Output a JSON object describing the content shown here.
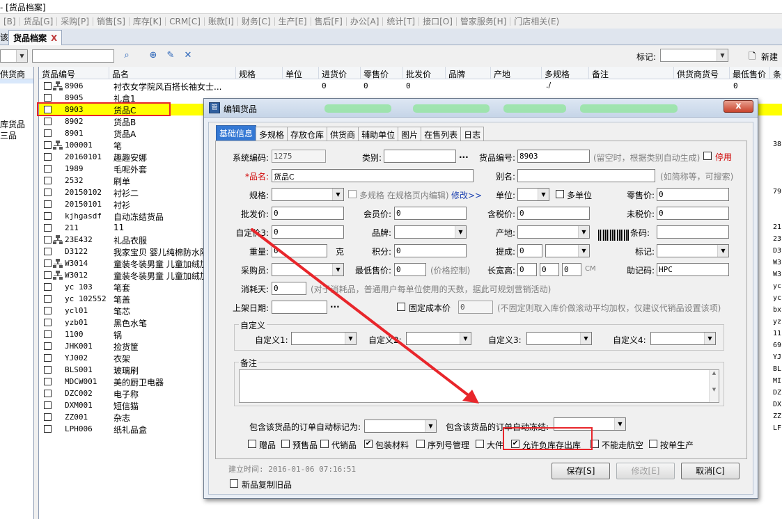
{
  "window_title": "- [货品档案]",
  "menu": [
    "[B]",
    "货品[G]",
    "采购[P]",
    "销售[S]",
    "库存[K]",
    "CRM[C]",
    "账款[I]",
    "财务[C]",
    "生产[E]",
    "售后[F]",
    "办公[A]",
    "统计[T]",
    "接口[O]",
    "管家服务[H]",
    "门店相关(E)"
  ],
  "tabs": {
    "prev_label": "该",
    "active_label": "货品档案",
    "close": "X"
  },
  "toolbar": {
    "mark_label": "标记:",
    "new_label": "新建"
  },
  "left_pane": {
    "header": "供货商",
    "labels": [
      "库货品",
      "三品"
    ]
  },
  "grid": {
    "headers": [
      "货品编号",
      "品名",
      "规格",
      "单位",
      "进货价",
      "零售价",
      "批发价",
      "品牌",
      "产地",
      "多规格",
      "备注",
      "供货商货号",
      "最低售价",
      "条"
    ],
    "rows": [
      {
        "code": "8906",
        "name": "衬衣女学院风百搭长袖女士...",
        "p1": "0",
        "p2": "0",
        "p3": "0",
        "multi": "./",
        "min": "0",
        "edge": ""
      },
      {
        "code": "8905",
        "name": "礼盒1",
        "p1": "",
        "p2": "",
        "p3": "",
        "multi": "",
        "min": "",
        "edge": ""
      },
      {
        "code": "8903",
        "name": "货品C",
        "p1": "",
        "p2": "",
        "p3": "",
        "multi": "",
        "min": "",
        "edge": ""
      },
      {
        "code": "8902",
        "name": "货品B",
        "p1": "",
        "p2": "",
        "p3": "",
        "multi": "",
        "min": "",
        "edge": ""
      },
      {
        "code": "8901",
        "name": "货品A",
        "p1": "",
        "p2": "",
        "p3": "",
        "multi": "",
        "min": "",
        "edge": ""
      },
      {
        "code": "100001",
        "name": "笔",
        "p1": "",
        "p2": "",
        "p3": "",
        "multi": "",
        "min": "",
        "edge": "38"
      },
      {
        "code": "20160101",
        "name": "趣趣安娜",
        "p1": "",
        "p2": "",
        "p3": "",
        "multi": "",
        "min": "",
        "edge": ""
      },
      {
        "code": "1989",
        "name": "毛呢外套",
        "p1": "",
        "p2": "",
        "p3": "",
        "multi": "",
        "min": "",
        "edge": ""
      },
      {
        "code": "2532",
        "name": "刷单",
        "p1": "",
        "p2": "",
        "p3": "",
        "multi": "",
        "min": "",
        "edge": ""
      },
      {
        "code": "20150102",
        "name": "衬衫二",
        "p1": "",
        "p2": "",
        "p3": "",
        "multi": "",
        "min": "",
        "edge": "79"
      },
      {
        "code": "20150101",
        "name": "衬衫",
        "p1": "",
        "p2": "",
        "p3": "",
        "multi": "",
        "min": "",
        "edge": ""
      },
      {
        "code": "kjhgasdf",
        "name": "自动冻结货品",
        "p1": "",
        "p2": "",
        "p3": "",
        "multi": "",
        "min": "",
        "edge": ""
      },
      {
        "code": "211",
        "name": "11",
        "p1": "",
        "p2": "",
        "p3": "",
        "multi": "",
        "min": "",
        "edge": "21"
      },
      {
        "code": "23E432",
        "name": "礼品衣服",
        "p1": "",
        "p2": "",
        "p3": "",
        "multi": "",
        "min": "",
        "edge": "23"
      },
      {
        "code": "D3122",
        "name": "我家宝贝 婴儿纯棉防水隔",
        "p1": "",
        "p2": "",
        "p3": "",
        "multi": "",
        "min": "",
        "edge": "D3"
      },
      {
        "code": "W3014",
        "name": "童装冬装男童 儿童加绒加",
        "p1": "",
        "p2": "",
        "p3": "",
        "multi": "",
        "min": "",
        "edge": "W3"
      },
      {
        "code": "W3012",
        "name": "童装冬装男童 儿童加绒加",
        "p1": "",
        "p2": "",
        "p3": "",
        "multi": "",
        "min": "",
        "edge": "W3"
      },
      {
        "code": "yc 103",
        "name": "笔套",
        "p1": "",
        "p2": "",
        "p3": "",
        "multi": "",
        "min": "",
        "edge": "yc"
      },
      {
        "code": "yc 102552",
        "name": "笔盖",
        "p1": "",
        "p2": "",
        "p3": "",
        "multi": "",
        "min": "",
        "edge": "yc"
      },
      {
        "code": "ycl01",
        "name": "笔芯",
        "p1": "",
        "p2": "",
        "p3": "",
        "multi": "",
        "min": "",
        "edge": "bx"
      },
      {
        "code": "yzb01",
        "name": "黑色水笔",
        "p1": "",
        "p2": "",
        "p3": "",
        "multi": "",
        "min": "",
        "edge": "yz"
      },
      {
        "code": "1100",
        "name": "锅",
        "p1": "",
        "p2": "",
        "p3": "",
        "multi": "",
        "min": "",
        "edge": "11"
      },
      {
        "code": "JHK001",
        "name": "捡货筐",
        "p1": "",
        "p2": "",
        "p3": "",
        "multi": "",
        "min": "",
        "edge": "69"
      },
      {
        "code": "YJ002",
        "name": "衣架",
        "p1": "",
        "p2": "",
        "p3": "",
        "multi": "",
        "min": "",
        "edge": "YJ"
      },
      {
        "code": "BLS001",
        "name": "玻璃刷",
        "p1": "",
        "p2": "",
        "p3": "",
        "multi": "",
        "min": "",
        "edge": "BL"
      },
      {
        "code": "MDCW001",
        "name": "美的厨卫电器",
        "p1": "",
        "p2": "",
        "p3": "",
        "multi": "",
        "min": "",
        "edge": "MI"
      },
      {
        "code": "DZC002",
        "name": "电子称",
        "p1": "",
        "p2": "",
        "p3": "",
        "multi": "",
        "min": "",
        "edge": "DZ"
      },
      {
        "code": "DXM001",
        "name": "短信猫",
        "p1": "",
        "p2": "",
        "p3": "",
        "multi": "",
        "min": "",
        "edge": "DX"
      },
      {
        "code": "ZZ001",
        "name": "杂志",
        "p1": "",
        "p2": "",
        "p3": "",
        "multi": "",
        "min": "",
        "edge": "ZZ"
      },
      {
        "code": "LPH006",
        "name": "纸礼品盒",
        "p1": "",
        "p2": "",
        "p3": "",
        "multi": "",
        "min": "",
        "edge": "LF"
      }
    ]
  },
  "dialog": {
    "title": "编辑货品",
    "close": "x",
    "tabs": [
      "基础信息",
      "多规格",
      "存放仓库",
      "供货商",
      "辅助单位",
      "图片",
      "在售列表",
      "日志"
    ],
    "fields": {
      "sys_code_label": "系统编码:",
      "sys_code": "1275",
      "category_label": "类别:",
      "ellipsis": "...",
      "goods_no_label": "货品编号:",
      "goods_no": "8903",
      "goods_no_hint": "(留空时，根据类别自动生成)",
      "disable_label": "停用",
      "name_label": "*品名:",
      "name": "货品C",
      "alias_label": "别名:",
      "alias_hint": "(如简称等，可搜索)",
      "spec_label": "规格:",
      "multispec_label": "多规格 在规格页内编辑)",
      "modify_link": "修改>>",
      "unit_label": "单位:",
      "multiunit_label": "多单位",
      "retail_label": "零售价:",
      "retail": "0",
      "wholesale_label": "批发价:",
      "wholesale": "0",
      "member_label": "会员价:",
      "member": "0",
      "taxed_label": "含税价:",
      "taxed": "0",
      "untaxed_label": "未税价:",
      "untaxed": "0",
      "custom_price_label": "自定价3:",
      "custom_price": "0",
      "brand_label": "品牌:",
      "origin_label": "产地:",
      "barcode_label": "条码:",
      "weight_label": "重量:",
      "weight": "0",
      "weight_unit": "克",
      "points_label": "积分:",
      "points": "0",
      "commission_label": "提成:",
      "commission": "0",
      "mark_label": "标记:",
      "buyer_label": "采购员:",
      "min_price_label": "最低售价:",
      "min_price": "0",
      "price_ctrl": "(价格控制)",
      "lwh_label": "长宽高:",
      "l": "0",
      "w": "0",
      "h": "0",
      "cm": "CM",
      "mnemonic_label": "助记码:",
      "mnemonic": "HPC",
      "consume_label": "消耗天:",
      "consume": "0",
      "consume_hint": "(对于消耗品，普通用户每单位使用的天数，据此可规划营销活动)",
      "shelf_label": "上架日期:",
      "shelf_ellipsis": "...",
      "fixed_cost_label": "固定成本价",
      "fixed_cost": "0",
      "fixed_cost_hint": "(不固定则取入库价做滚动平均加权，仅建议代销品设置该项)"
    },
    "custom_group": {
      "caption": "自定义",
      "labels": [
        "自定义1:",
        "自定义2:",
        "自定义3:",
        "自定义4:"
      ]
    },
    "remark_group": {
      "caption": "备注"
    },
    "auto_mark_label": "包含该货品的订单自动标记为:",
    "auto_freeze_label": "包含该货品的订单自动冻结:",
    "checkboxes": [
      {
        "label": "赠品",
        "checked": false
      },
      {
        "label": "预售品",
        "checked": false
      },
      {
        "label": "代销品",
        "checked": false
      },
      {
        "label": "包装材料",
        "checked": true
      },
      {
        "label": "序列号管理",
        "checked": false
      },
      {
        "label": "大件",
        "checked": false
      },
      {
        "label": "允许负库存出库",
        "checked": true
      },
      {
        "label": "不能走航空",
        "checked": false
      },
      {
        "label": "按单生产",
        "checked": false
      }
    ],
    "created": "建立时间: 2016-01-06 07:16:51",
    "copy_label": "新品复制旧品",
    "buttons": {
      "save": "保存[S]",
      "modify": "修改[E]",
      "cancel": "取消[C]"
    }
  },
  "colors": {
    "highlight_row": "#ffff00",
    "annotation_red": "#e8262b",
    "active_tab": "#3478d4"
  }
}
